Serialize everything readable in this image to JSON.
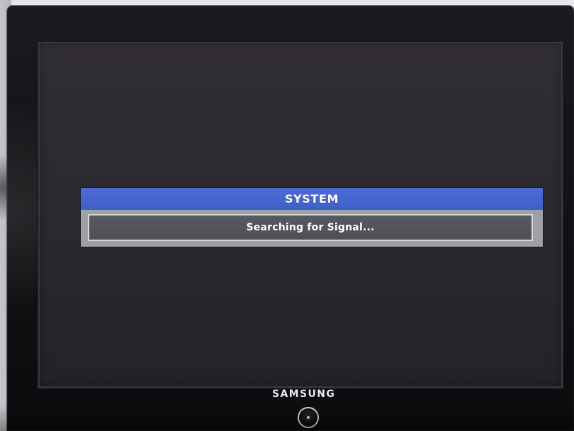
{
  "dialog": {
    "title": "SYSTEM",
    "message": "Searching for Signal..."
  },
  "monitor": {
    "brand": "SAMSUNG"
  },
  "colors": {
    "dialog_title_bar": "#4C6BD6",
    "dialog_frame": "#9FA0A7",
    "dialog_body": "#56555C",
    "screen": "#2F2C31",
    "bezel": "#121114"
  },
  "icons": {
    "power": "power-icon"
  }
}
